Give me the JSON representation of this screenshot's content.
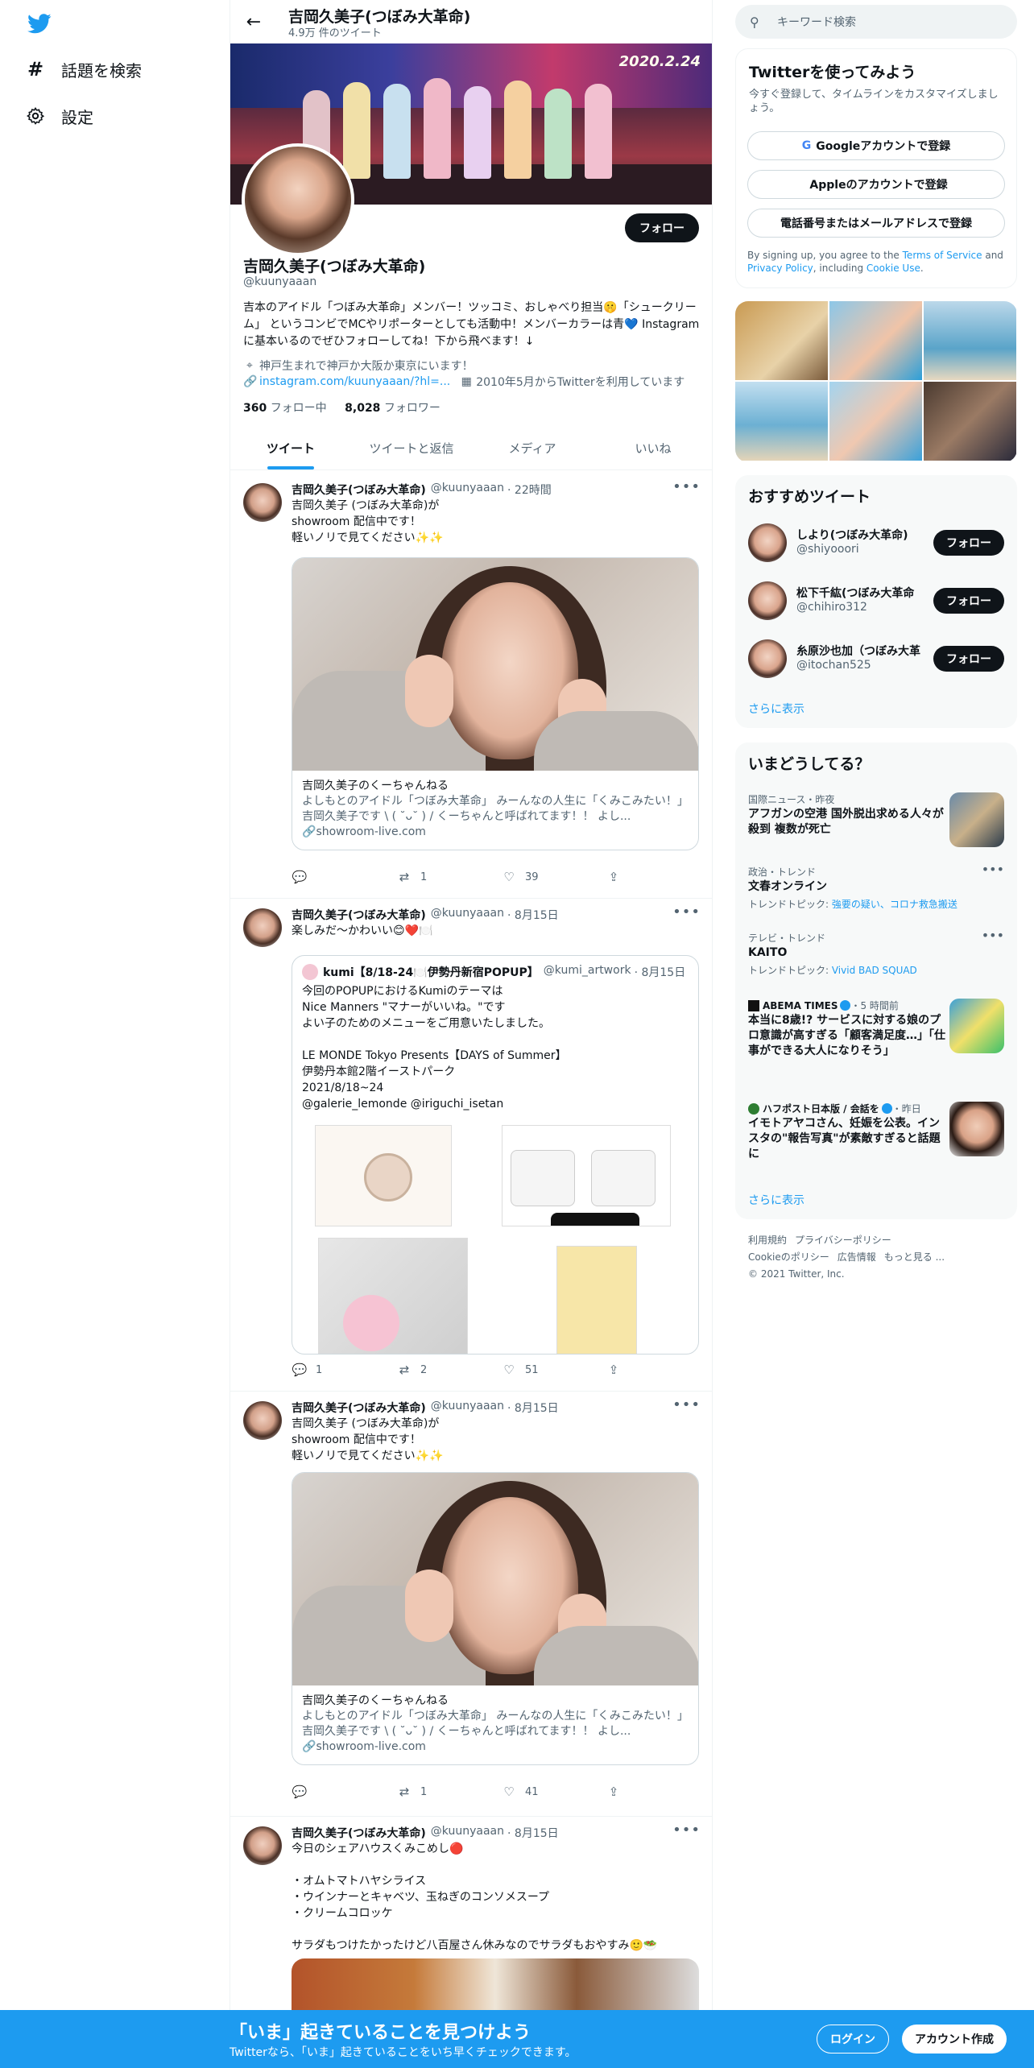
{
  "nav": {
    "items": [
      {
        "icon": "hash-icon",
        "label": "話題を検索"
      },
      {
        "icon": "gear-icon",
        "label": "設定"
      }
    ]
  },
  "header": {
    "title": "吉岡久美子(つぼみ大革命)",
    "subtitle": "4.9万 件のツイート"
  },
  "banner": {
    "date_text": "2020.2.24"
  },
  "profile": {
    "follow_label": "フォロー",
    "name": "吉岡久美子(つぼみ大革命)",
    "handle": "@kuunyaaan",
    "bio": "吉本のアイドル「つぼみ大革命」メンバー！ツッコミ、おしゃべり担当🤫「シュークリーム」 というコンビでMCやリポーターとしても活動中！メンバーカラーは青💙 Instagramに基本いるのでぜひフォローしてね！下から飛べます！↓",
    "location": "神戸生まれで神戸か大阪か東京にいます！",
    "link": "instagram.com/kuunyaaan/?hl=...",
    "joined": "2010年5月からTwitterを利用しています",
    "following_count": "360",
    "following_label": "フォロー中",
    "followers_count": "8,028",
    "followers_label": "フォロワー"
  },
  "tabs": [
    "ツイート",
    "ツイートと返信",
    "メディア",
    "いいね"
  ],
  "tweets": [
    {
      "name": "吉岡久美子(つぼみ大革命)",
      "handle": "@kuunyaaan",
      "time": "22時間",
      "text": "吉岡久美子 (つぼみ大革命)が\nshowroom 配信中です！\n軽いノリで見てください✨✨",
      "card_title": "吉岡久美子のくーちゃんねる",
      "card_desc": "よしもとのアイドル「つぼみ大革命」 みーんなの人生に「くみこみたい！」 吉岡久美子です \\ ( ˘ᴗ˘ ) / くーちゃんと呼ばれてます！！ よし...",
      "card_domain": "showroom-live.com",
      "replies": "",
      "retweets": "1",
      "likes": "39"
    },
    {
      "name": "吉岡久美子(つぼみ大革命)",
      "handle": "@kuunyaaan",
      "time": "8月15日",
      "text": "楽しみだ〜かわいい😊❤️🍽️",
      "quote_name": "kumi【8/18-24🍽️伊勢丹新宿POPUP】",
      "quote_handle": "@kumi_artwork",
      "quote_time": "8月15日",
      "quote_text": "今回のPOPUPにおけるKumiのテーマは\nNice Manners \"マナーがいいね。\"です\nよい子のためのメニューをご用意いたしました。\n\nLE MONDE Tokyo Presents【DAYS of Summer】\n伊勢丹本館2階イーストパーク\n2021/8/18~24\n@galerie_lemonde @iriguchi_isetan",
      "replies": "1",
      "retweets": "2",
      "likes": "51"
    },
    {
      "name": "吉岡久美子(つぼみ大革命)",
      "handle": "@kuunyaaan",
      "time": "8月15日",
      "text": "吉岡久美子 (つぼみ大革命)が\nshowroom 配信中です！\n軽いノリで見てください✨✨",
      "card_title": "吉岡久美子のくーちゃんねる",
      "card_desc": "よしもとのアイドル「つぼみ大革命」 みーんなの人生に「くみこみたい！」 吉岡久美子です \\ ( ˘ᴗ˘ ) / くーちゃんと呼ばれてます！！ よし...",
      "card_domain": "showroom-live.com",
      "replies": "",
      "retweets": "1",
      "likes": "41"
    },
    {
      "name": "吉岡久美子(つぼみ大革命)",
      "handle": "@kuunyaaan",
      "time": "8月15日",
      "text": "今日のシェアハウスくみこめし🔴\n\n・オムトマトハヤシライス\n・ウインナーとキャベツ、玉ねぎのコンソメスープ\n・クリームコロッケ\n\nサラダもつけたかったけど八百屋さん休みなのでサラダもおやすみ🙂🥗"
    }
  ],
  "search": {
    "placeholder": "キーワード検索"
  },
  "signup": {
    "title": "Twitterを使ってみよう",
    "subtitle": "今すぐ登録して、タイムラインをカスタマイズしましょう。",
    "google": "Googleアカウントで登録",
    "apple": "Appleのアカウントで登録",
    "phone": "電話番号またはメールアドレスで登録",
    "legal_1": "By signing up, you agree to the ",
    "tos": "Terms of Service",
    "legal_2": " and ",
    "privacy": "Privacy Policy",
    "legal_3": ", including ",
    "cookie": "Cookie Use",
    "legal_4": "."
  },
  "recommended": {
    "title": "おすすめツイート",
    "users": [
      {
        "name": "しより(つぼみ大革命)",
        "handle": "@shiyooori"
      },
      {
        "name": "松下千紘(つぼみ大革命",
        "handle": "@chihiro312"
      },
      {
        "name": "糸原沙也加（つぼみ大革",
        "handle": "@itochan525"
      }
    ],
    "follow_label": "フォロー",
    "more": "さらに表示"
  },
  "trends": {
    "title": "いまどうしてる？",
    "items": [
      {
        "category": "国際ニュース・昨夜",
        "title": "アフガンの空港 国外脱出求める人々が殺到 複数が死亡"
      },
      {
        "category": "政治・トレンド",
        "title": "文春オンライン",
        "sub_label": "トレンドトピック: ",
        "sub_links": "強要の疑い、コロナ救急搬送"
      },
      {
        "category": "テレビ・トレンド",
        "title": "KAITO",
        "sub_label": "トレンドトピック: ",
        "sub_links": "Vivid BAD SQUAD"
      },
      {
        "category_source": "ABEMA TIMES",
        "category_time": "・5 時間前",
        "title": "本当に8歳!? サービスに対する娘のプロ意識が高すぎる「顧客満足度…」「仕事ができる大人になりそう」"
      },
      {
        "category_source": "ハフポスト日本版 / 会話を",
        "category_time": "・昨日",
        "title": "イモトアヤコさん、妊娠を公表。インスタの\"報告写真\"が素敵すぎると話題に"
      }
    ],
    "more": "さらに表示"
  },
  "footer": {
    "links": [
      "利用規約",
      "プライバシーポリシー",
      "Cookieのポリシー",
      "広告情報",
      "もっと見る ..."
    ],
    "copyright": "© 2021 Twitter, Inc."
  },
  "bottombar": {
    "title": "「いま」起きていることを見つけよう",
    "subtitle": "Twitterなら、「いま」起きていることをいち早くチェックできます。",
    "login": "ログイン",
    "signup": "アカウント作成"
  },
  "colors": {
    "accent": "#1d9bf0",
    "text": "#0f1419",
    "muted": "#536471"
  }
}
